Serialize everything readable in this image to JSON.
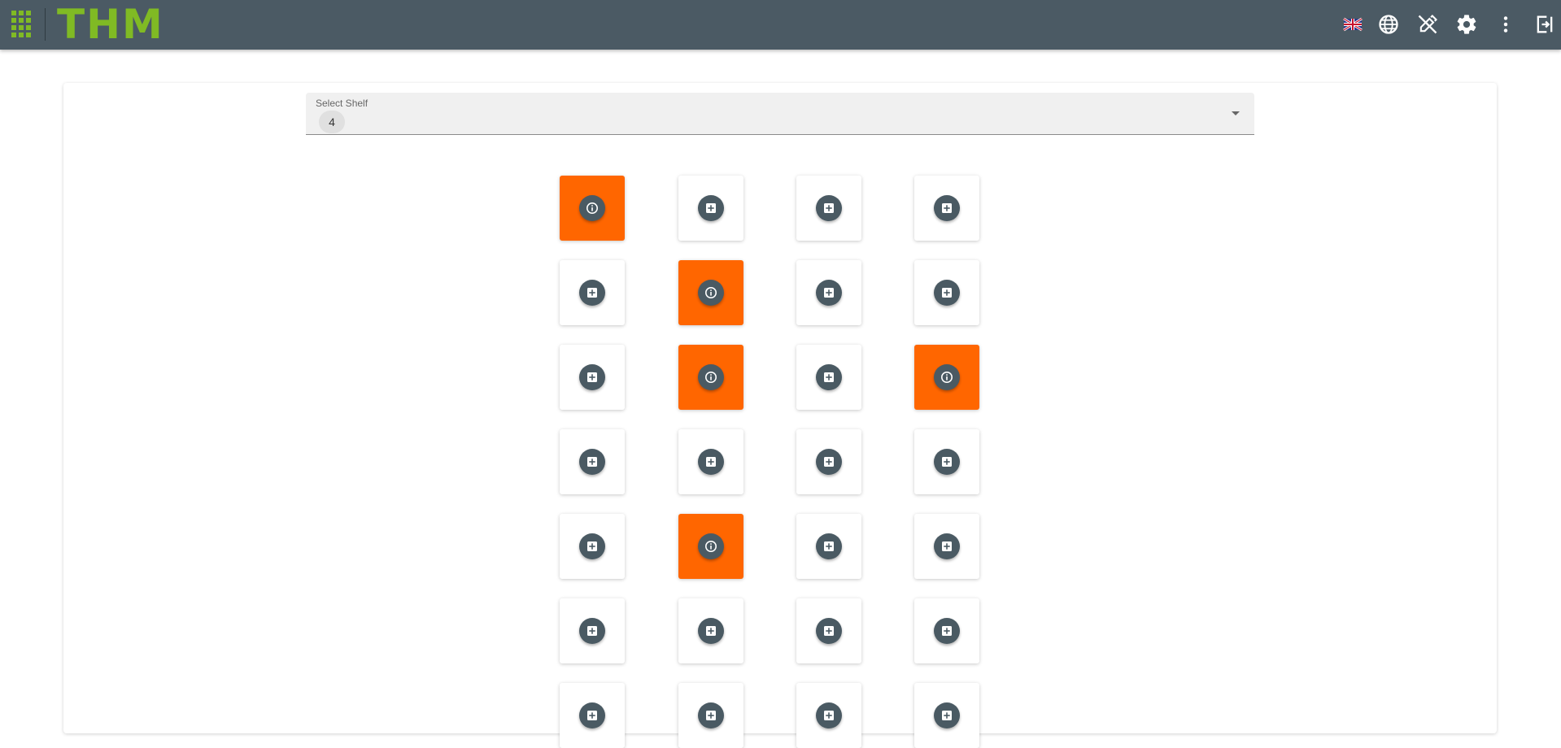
{
  "app": {
    "logo_text": "THM",
    "brand_color": "#80ba24",
    "header_color": "#4b5a64"
  },
  "header_icons": [
    {
      "name": "uk-flag-icon"
    },
    {
      "name": "globe-icon"
    },
    {
      "name": "edit-off-icon"
    },
    {
      "name": "settings-gear-icon"
    },
    {
      "name": "more-vert-icon"
    },
    {
      "name": "logout-icon"
    }
  ],
  "shelf_select": {
    "label": "Select Shelf",
    "value": "4"
  },
  "colors": {
    "occupied": "#ff6600",
    "empty": "#ffffff",
    "action_button": "#4a5a63"
  },
  "grid": {
    "columns": 4,
    "rows": [
      [
        "occupied",
        "empty",
        "empty",
        "empty"
      ],
      [
        "empty",
        "occupied",
        "empty",
        "empty"
      ],
      [
        "empty",
        "occupied",
        "empty",
        "occupied"
      ],
      [
        "empty",
        "empty",
        "empty",
        "empty"
      ],
      [
        "empty",
        "occupied",
        "empty",
        "empty"
      ],
      [
        "empty",
        "empty",
        "empty",
        "empty"
      ],
      [
        "empty",
        "empty",
        "empty",
        "empty"
      ]
    ],
    "icons": {
      "occupied": "info-icon",
      "empty": "add-box-icon"
    }
  }
}
